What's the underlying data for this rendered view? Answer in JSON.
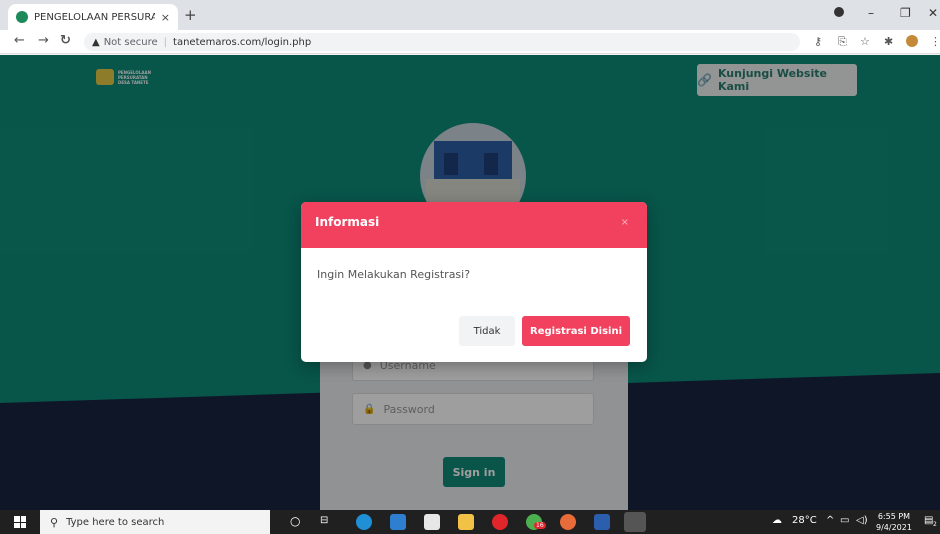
{
  "browser": {
    "tab_title": "PENGELOLAAN PERSURATAN DE",
    "tab_close": "×",
    "new_tab": "+",
    "security_label": "Not secure",
    "url": "tanetemaros.com/login.php",
    "window_buttons": [
      "–",
      "❐",
      "✕"
    ]
  },
  "header": {
    "logo_lines": [
      "PENGELOLAAN",
      "PERSURATAN",
      "DESA TANETE"
    ],
    "visit_button": "Kunjungi Website Kami"
  },
  "login": {
    "username_placeholder": "Username",
    "password_placeholder": "Password",
    "signin_label": "Sign in"
  },
  "modal": {
    "title": "Informasi",
    "close": "×",
    "message": "Ingin Melakukan Registrasi?",
    "cancel_label": "Tidak",
    "confirm_label": "Registrasi Disini"
  },
  "taskbar": {
    "search_placeholder": "Type here to search",
    "weather": "28°C",
    "time": "6:55 PM",
    "date": "9/4/2021",
    "notif_count": "2",
    "badge_count": "16"
  },
  "colors": {
    "teal": "#0e8a78",
    "navy": "#17243f",
    "modal_red": "#f1415f"
  }
}
